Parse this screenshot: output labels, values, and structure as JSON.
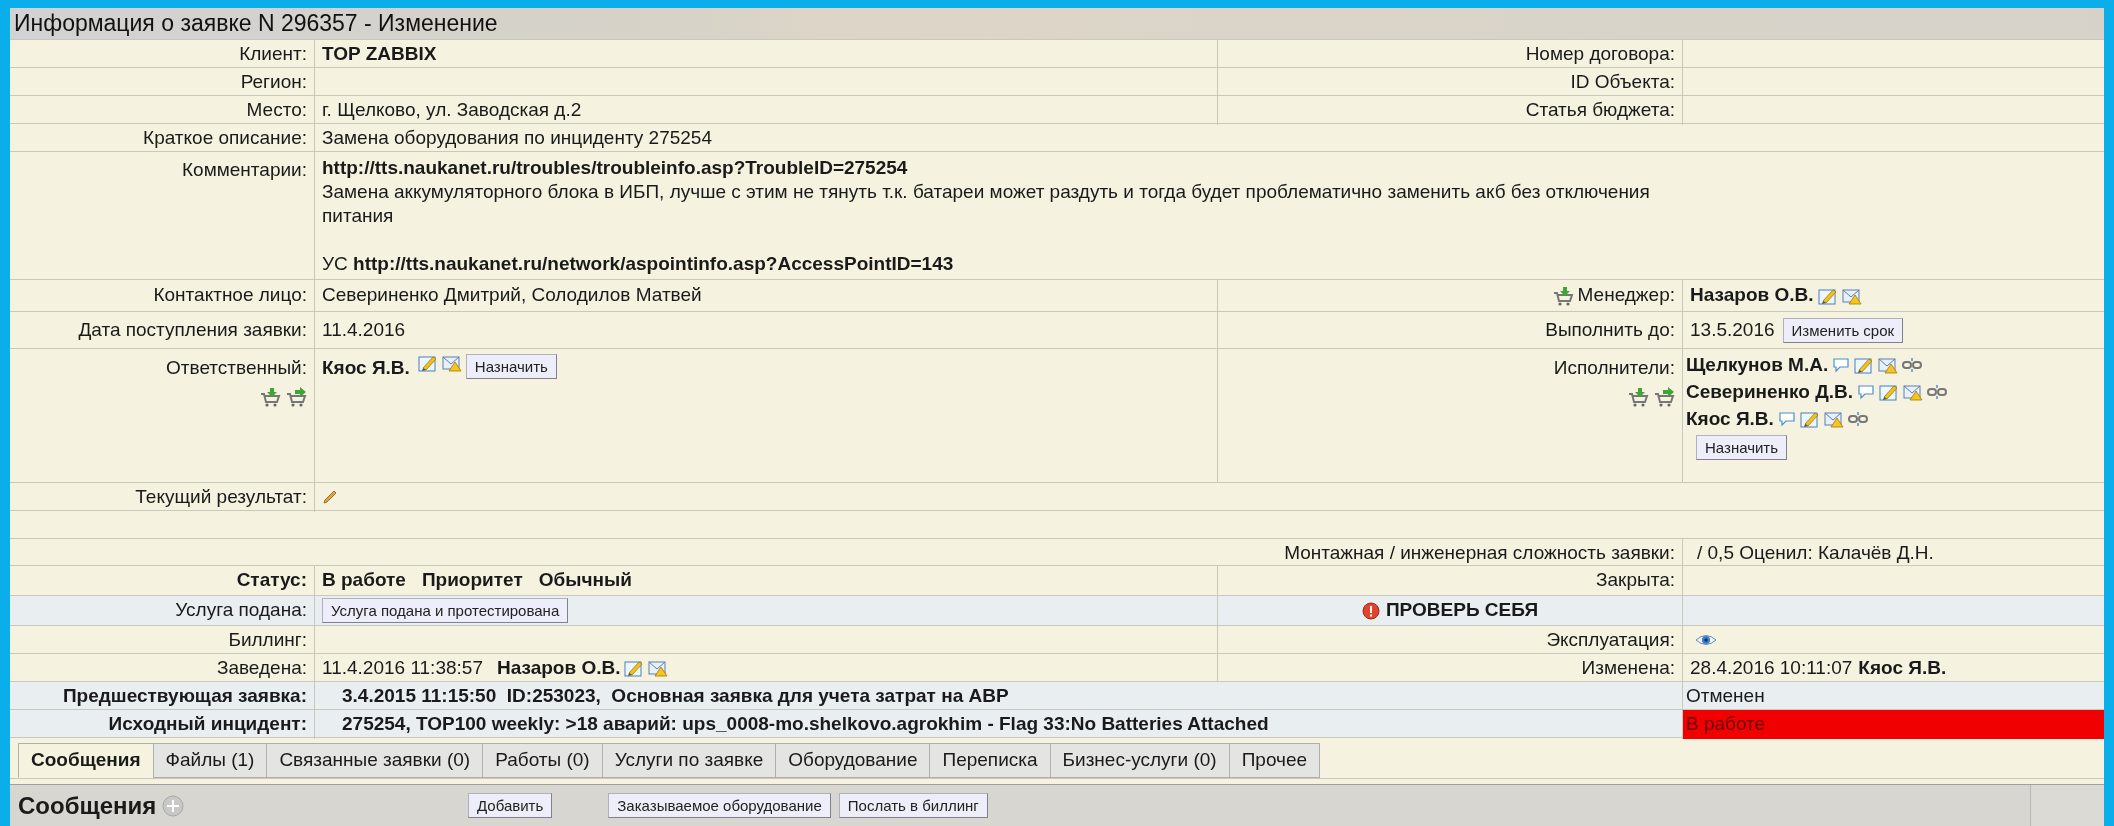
{
  "window": {
    "title": "Информация о заявке N 296357 - Изменение"
  },
  "header_rows": [
    {
      "label": "Клиент:",
      "value": "TOP ZABBIX",
      "bold": true,
      "right_label": "Номер договора:"
    },
    {
      "label": "Регион:",
      "right_label": "ID Объекта:"
    },
    {
      "label": "Место:",
      "value": "г. Щелково, ул. Заводская д.2",
      "bold": false,
      "right_label": "Статья бюджета:"
    }
  ],
  "summary": {
    "label": "Краткое описание:",
    "value": "Замена оборудования по инциденту 275254"
  },
  "comments": {
    "label": "Комментарии:",
    "paragraphs": [
      "**http://tts.naukanet.ru/troubles/troubleinfo.asp?TroubleID=275254**",
      "Замена аккумуляторного блока в ИБП, лучше с этим не тянуть т.к. батареи может раздуть и тогда будет проблематично заменить акб без отключения питания",
      "УС **http://tts.naukanet.ru/network/aspointinfo.asp?AccessPointID=143**"
    ]
  },
  "contact": {
    "label": "Контактное лицо:",
    "value": "Севериненко Дмитрий, Солодилов Матвей",
    "manager_label": "Менеджер:",
    "manager": "Назаров О.В."
  },
  "received": {
    "label": "Дата поступления заявки:",
    "value": "11.4.2016",
    "due_label": "Выполнить до:",
    "due": "13.5.2016",
    "due_button": "Изменить срок"
  },
  "responsible": {
    "label": "Ответственный:",
    "person": "Кяос Я.В.",
    "button": "Назначить",
    "executors_label": "Исполнители:",
    "executors": [
      "Щелкунов М.А.",
      "Севериненко Д.В.",
      "Кяос Я.В."
    ],
    "executors_button": "Назначить"
  },
  "current_result": {
    "label": "Текущий результат:"
  },
  "complexity": {
    "label": "Монтажная / инженерная сложность заявки:",
    "value": "/ 0,5 Оценил: Калачёв Д.Н."
  },
  "status": {
    "label": "Статус:",
    "value": "В работе",
    "priority_label": "Приоритет",
    "priority": "Обычный",
    "closed_label": "Закрыта:"
  },
  "service": {
    "label": "Услуга подана:",
    "button": "Услуга подана и протестирована",
    "warning": "ПРОВЕРЬ СЕБЯ"
  },
  "billing": {
    "label": "Биллинг:",
    "operation_label": "Эксплуатация:"
  },
  "created": {
    "label": "Заведена:",
    "time": "11.4.2016 11:38:57",
    "person": "Назаров О.В.",
    "changed_label": "Изменена:",
    "changed_time": "28.4.2016 10:11:07",
    "changed_person": "Кяос Я.В."
  },
  "related": [
    {
      "label": "Предшествующая заявка:",
      "value": "3.4.2015 11:15:50  ID:253023,  Основная заявка для учета затрат на АВР",
      "state": "Отменен",
      "highlight": false
    },
    {
      "label": "Исходный инцидент:",
      "value": "275254, TOP100 weekly: >18 аварий: ups_0008-mo.shelkovo.agrokhim - Flag 33:No Batteries Attached",
      "state": "В работе",
      "highlight": true
    }
  ],
  "tabs": [
    {
      "label": "Сообщения",
      "selected": true
    },
    {
      "label": "Файлы (1)",
      "selected": false
    },
    {
      "label": "Связанные заявки (0)",
      "selected": false
    },
    {
      "label": "Работы (0)",
      "selected": false
    },
    {
      "label": "Услуги по заявке",
      "selected": false
    },
    {
      "label": "Оборудование",
      "selected": false
    },
    {
      "label": "Переписка",
      "selected": false
    },
    {
      "label": "Бизнес-услуги (0)",
      "selected": false
    },
    {
      "label": "Прочее",
      "selected": false
    }
  ],
  "messages_bar": {
    "title": "Сообщения",
    "buttons": [
      "Добавить",
      "Заказываемое оборудование",
      "Послать в биллинг"
    ]
  }
}
